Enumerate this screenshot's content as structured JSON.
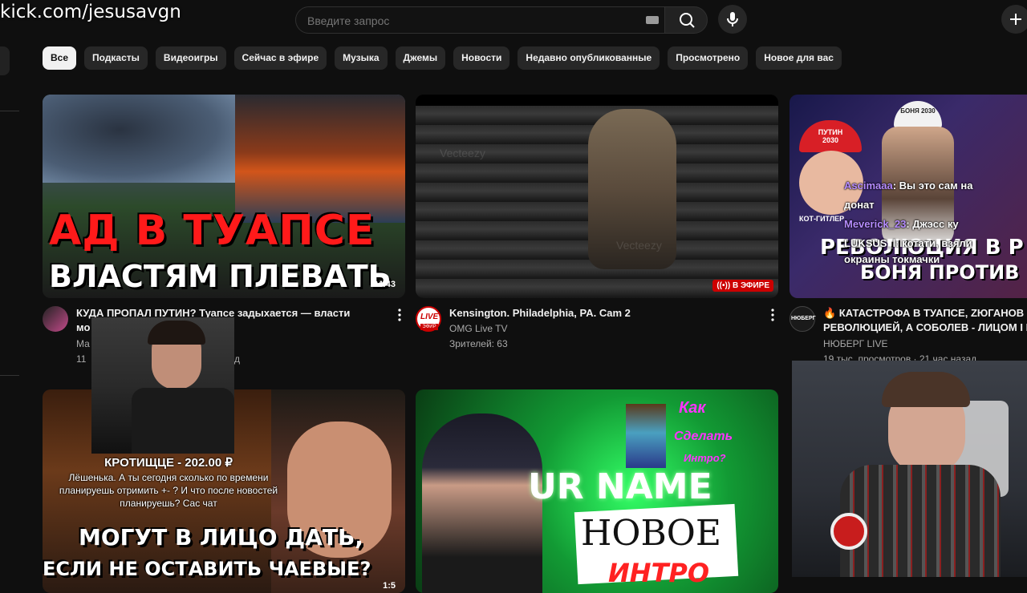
{
  "overlay": {
    "channel_url": "kick.com/jesusavgn"
  },
  "search": {
    "placeholder": "Введите запрос"
  },
  "chips": [
    "Все",
    "Подкасты",
    "Видеоигры",
    "Сейчас в эфире",
    "Музыка",
    "Джемы",
    "Новости",
    "Недавно опубликованные",
    "Просмотрено",
    "Новое для вас"
  ],
  "videos": [
    {
      "thumb_line1": "АД В ТУАПСЕ",
      "thumb_line2": "ВЛАСТЯМ ПЛЕВАТЬ",
      "duration": "24:43",
      "title": "КУДА ПРОПАЛ ПУТИН? Туапсе задыхается — власти",
      "title_line2": "мо",
      "channel": "Ма",
      "meta": "11",
      "meta_tail": "д"
    },
    {
      "live_badge": "В ЭФИРЕ",
      "title": "Kensington. Philadelphia, PA. Cam 2",
      "channel": "OMG Live TV",
      "meta": "Зрителей: 63",
      "avatar_text_top": "LIVE",
      "avatar_text_bottom": "ЭФИР",
      "watermark": "Vecteezy"
    },
    {
      "title": "🔥 КАТАСТРОФА В ТУАПСЕ, ZЮГАНОВ П",
      "title_line2": "РЕВОЛЮЦИЕЙ, А СОБОЛЕВ - ЛИЦОМ I М",
      "channel": "НЮБЕРГ LIVE",
      "meta": "19 тыс. просмотров · 21 час назад",
      "avatar_text": "НЮБЕРГ",
      "thumb_line1": "РЕВОЛЮЦИЯ В Р",
      "thumb_line2": "БОНЯ ПРОТИВ Б",
      "cap_text": "ПУТИН 2030",
      "cap2_text": "БОНЯ 2030",
      "tag_text": "КОТ-ГИТЛЕР"
    },
    {
      "thumb_line1": "МОГУТ В ЛИЦО ДАТЬ,",
      "thumb_line2": "ЕСЛИ НЕ ОСТАВИТЬ ЧАЕВЫЕ?",
      "duration": "1:5"
    },
    {
      "thumb_line1": "UR NAME",
      "thumb_line2": "НОВОЕ",
      "thumb_line3": "ИНТРО",
      "side1": "Как",
      "side2": "Сделать",
      "side3": "Интро?"
    },
    {}
  ],
  "chat_overlay": [
    {
      "user": "Ascimaaa",
      "text": ": Вы это сам на"
    },
    {
      "user": "",
      "text": "донат"
    },
    {
      "user": "Meverick_23",
      "text": ": Джэсс ку"
    },
    {
      "user": "LUKSUS_l",
      "text": ": котати, взяли"
    },
    {
      "user": "",
      "text": "окраины токмачки"
    }
  ],
  "donation": {
    "title": "КРОТИЩЦЕ - 202.00 ₽",
    "message": "Лёшенька. А ты сегодня сколько по времени планируешь отримить +- ? И что после новостей планируешь? Сас чат"
  },
  "colors": {
    "bg": "#0f0f0f",
    "chip": "#272727",
    "live": "#cc0000",
    "chat_user": "#b68cff"
  }
}
